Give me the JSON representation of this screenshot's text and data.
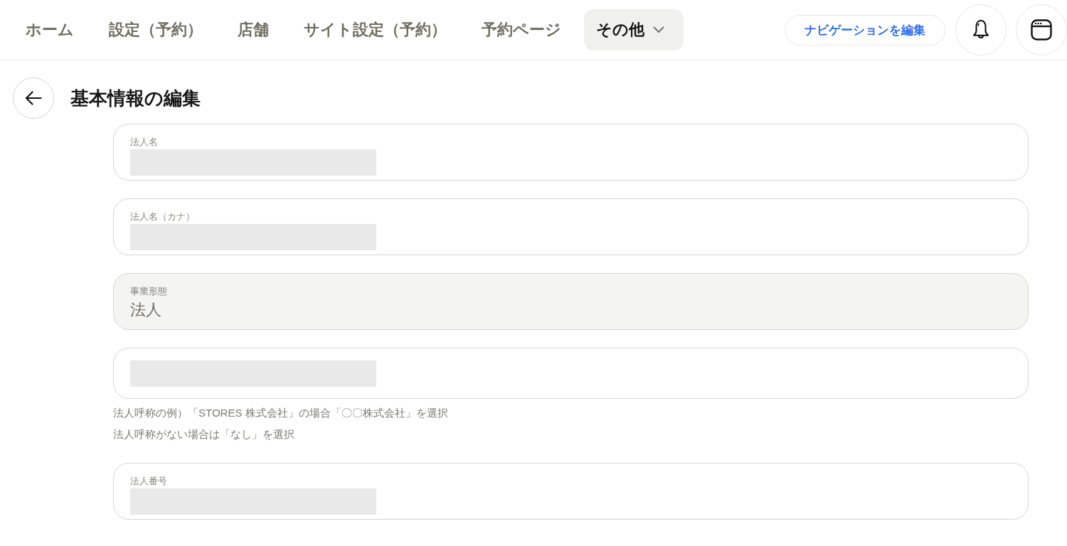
{
  "nav": {
    "tabs": [
      {
        "label": "ホーム",
        "selected": false,
        "dropdown": false
      },
      {
        "label": "設定（予約）",
        "selected": false,
        "dropdown": false
      },
      {
        "label": "店舗",
        "selected": false,
        "dropdown": false
      },
      {
        "label": "サイト設定（予約）",
        "selected": false,
        "dropdown": false
      },
      {
        "label": "予約ページ",
        "selected": false,
        "dropdown": false
      },
      {
        "label": "その他",
        "selected": true,
        "dropdown": true
      }
    ],
    "edit_button": "ナビゲーションを編集"
  },
  "page": {
    "title": "基本情報の編集"
  },
  "fields": [
    {
      "label": "法人名",
      "redacted": true,
      "disabled": false
    },
    {
      "label": "法人名（カナ）",
      "redacted": true,
      "disabled": false
    },
    {
      "label": "事業形態",
      "value": "法人",
      "redacted": false,
      "disabled": true
    },
    {
      "redacted": true,
      "disabled": false,
      "help": [
        "法人呼称の例）「STORES 株式会社」の場合「〇〇株式会社」を選択",
        "法人呼称がない場合は「なし」を選択"
      ]
    },
    {
      "label": "法人番号",
      "redacted": true,
      "disabled": false
    }
  ]
}
